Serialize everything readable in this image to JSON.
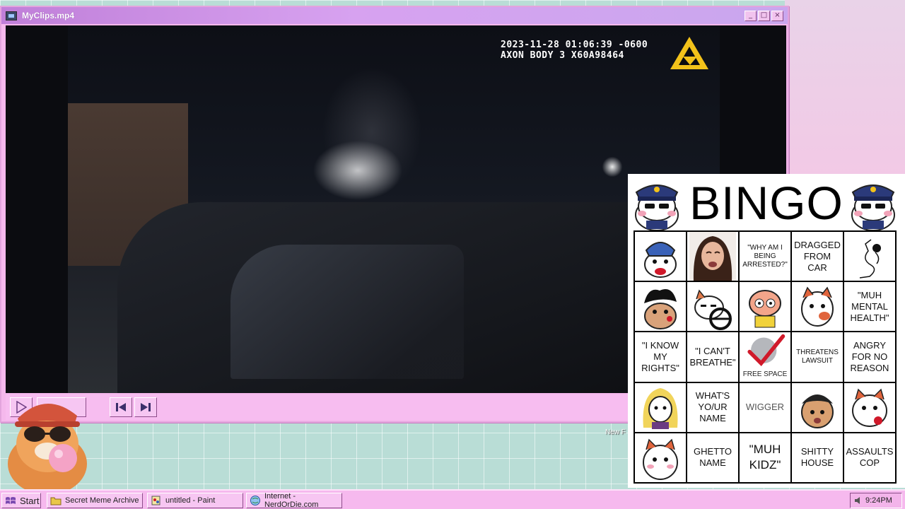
{
  "window": {
    "title": "MyClips.mp4",
    "minimize": "_",
    "maximize": "□",
    "close": "×"
  },
  "video": {
    "timestamp": "2023-11-28 01:06:39 -0600",
    "device": "AXON BODY 3 X60A98464"
  },
  "desktop": {
    "partial_icon_label": "New F"
  },
  "bingo": {
    "title": "BINGO",
    "cells": [
      {
        "text": "",
        "icon": "cat-sticker-icon"
      },
      {
        "text": "",
        "icon": "crying-woman-photo"
      },
      {
        "text": "\"WHY AM I BEING ARRESTED?\"",
        "style": "small"
      },
      {
        "text": "DRAGGED FROM CAR"
      },
      {
        "text": "",
        "icon": "figure-drawing-icon"
      },
      {
        "text": "",
        "icon": "cat-sticker-icon"
      },
      {
        "text": "",
        "icon": "cat-driving-icon"
      },
      {
        "text": "",
        "icon": "cat-sticker-icon"
      },
      {
        "text": "",
        "icon": "cat-sticker-icon"
      },
      {
        "text": "\"MUH MENTAL HEALTH\""
      },
      {
        "text": "\"I KNOW MY RIGHTS\""
      },
      {
        "text": "\"I CAN'T BREATHE\""
      },
      {
        "text": "",
        "icon": "checkmark-icon",
        "label": "FREE SPACE"
      },
      {
        "text": "THREATENS LAWSUIT",
        "style": "small"
      },
      {
        "text": "ANGRY FOR NO REASON"
      },
      {
        "text": "",
        "icon": "cat-sticker-icon"
      },
      {
        "text": "WHAT'S YO/UR NAME"
      },
      {
        "text": "WIGGER",
        "style": "grey"
      },
      {
        "text": "",
        "icon": "cat-sticker-icon"
      },
      {
        "text": "",
        "icon": "cat-sticker-icon"
      },
      {
        "text": "",
        "icon": "cat-sticker-icon"
      },
      {
        "text": "GHETTO NAME"
      },
      {
        "text": "\"MUH KIDZ\"",
        "style": "big"
      },
      {
        "text": "SHITTY HOUSE"
      },
      {
        "text": "ASSAULTS COP"
      }
    ]
  },
  "taskbar": {
    "start": "Start",
    "items": [
      "Secret Meme Archive",
      "untitled - Paint",
      "Internet - NerdOrDie.com"
    ],
    "clock": "9:24PM"
  },
  "colors": {
    "accent": "#f6b9ee",
    "title_gradient": "#c07fd9",
    "check": "#d0192a"
  }
}
